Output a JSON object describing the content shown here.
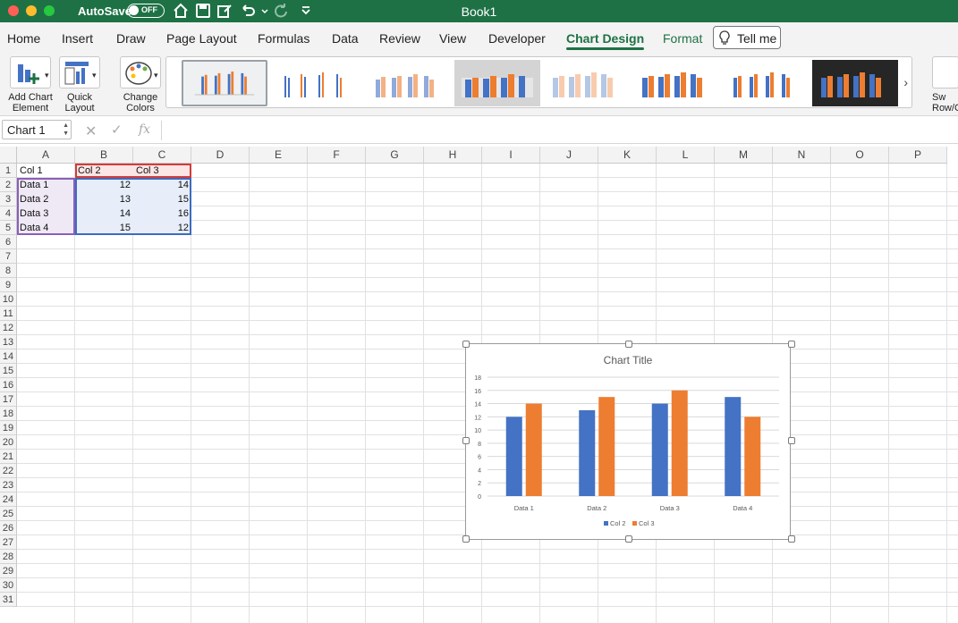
{
  "titlebar": {
    "autosave_label": "AutoSave",
    "autosave_state": "OFF",
    "book_title": "Book1"
  },
  "tabs": [
    {
      "label": "Home"
    },
    {
      "label": "Insert"
    },
    {
      "label": "Draw"
    },
    {
      "label": "Page Layout"
    },
    {
      "label": "Formulas"
    },
    {
      "label": "Data"
    },
    {
      "label": "Review"
    },
    {
      "label": "View"
    },
    {
      "label": "Developer"
    },
    {
      "label": "Chart Design"
    },
    {
      "label": "Format"
    }
  ],
  "tell_me": "Tell me",
  "ribbon": {
    "add_chart_element": [
      "Add Chart",
      "Element"
    ],
    "quick_layout": [
      "Quick",
      "Layout"
    ],
    "change_colors": [
      "Change",
      "Colors"
    ],
    "switch_row_col": [
      "Sw",
      "Row/C"
    ]
  },
  "formula_bar": {
    "name_box": "Chart 1",
    "cancel_icon": "✕",
    "enter_icon": "✓",
    "fx_label": "fx"
  },
  "columns": [
    "A",
    "B",
    "C",
    "D",
    "E",
    "F",
    "G",
    "H",
    "I",
    "J",
    "K",
    "L",
    "M",
    "N",
    "O",
    "P"
  ],
  "rows": [
    "1",
    "2",
    "3",
    "4",
    "5",
    "6",
    "7",
    "8",
    "9",
    "10",
    "11",
    "12",
    "13",
    "14",
    "15",
    "16",
    "17",
    "18",
    "19",
    "20",
    "21",
    "22",
    "23",
    "24",
    "25",
    "26",
    "27",
    "28",
    "29",
    "30",
    "31"
  ],
  "sheet": {
    "header": [
      "Col 1",
      "Col 2",
      "Col 3"
    ],
    "data": [
      [
        "Data 1",
        "12",
        "14"
      ],
      [
        "Data 2",
        "13",
        "15"
      ],
      [
        "Data 3",
        "14",
        "16"
      ],
      [
        "Data 4",
        "15",
        "12"
      ]
    ]
  },
  "colors": {
    "excel_green": "#1e7145",
    "series1": "#4472c4",
    "series2": "#ed7d31"
  },
  "chart_data": {
    "type": "bar",
    "title": "Chart Title",
    "categories": [
      "Data 1",
      "Data 2",
      "Data 3",
      "Data 4"
    ],
    "series": [
      {
        "name": "Col 2",
        "values": [
          12,
          13,
          14,
          15
        ],
        "color": "#4472c4"
      },
      {
        "name": "Col 3",
        "values": [
          14,
          15,
          16,
          12
        ],
        "color": "#ed7d31"
      }
    ],
    "ylim": [
      0,
      18
    ],
    "yticks": [
      "0",
      "2",
      "4",
      "6",
      "8",
      "10",
      "12",
      "14",
      "16",
      "18"
    ],
    "grid": true,
    "legend": "bottom"
  }
}
